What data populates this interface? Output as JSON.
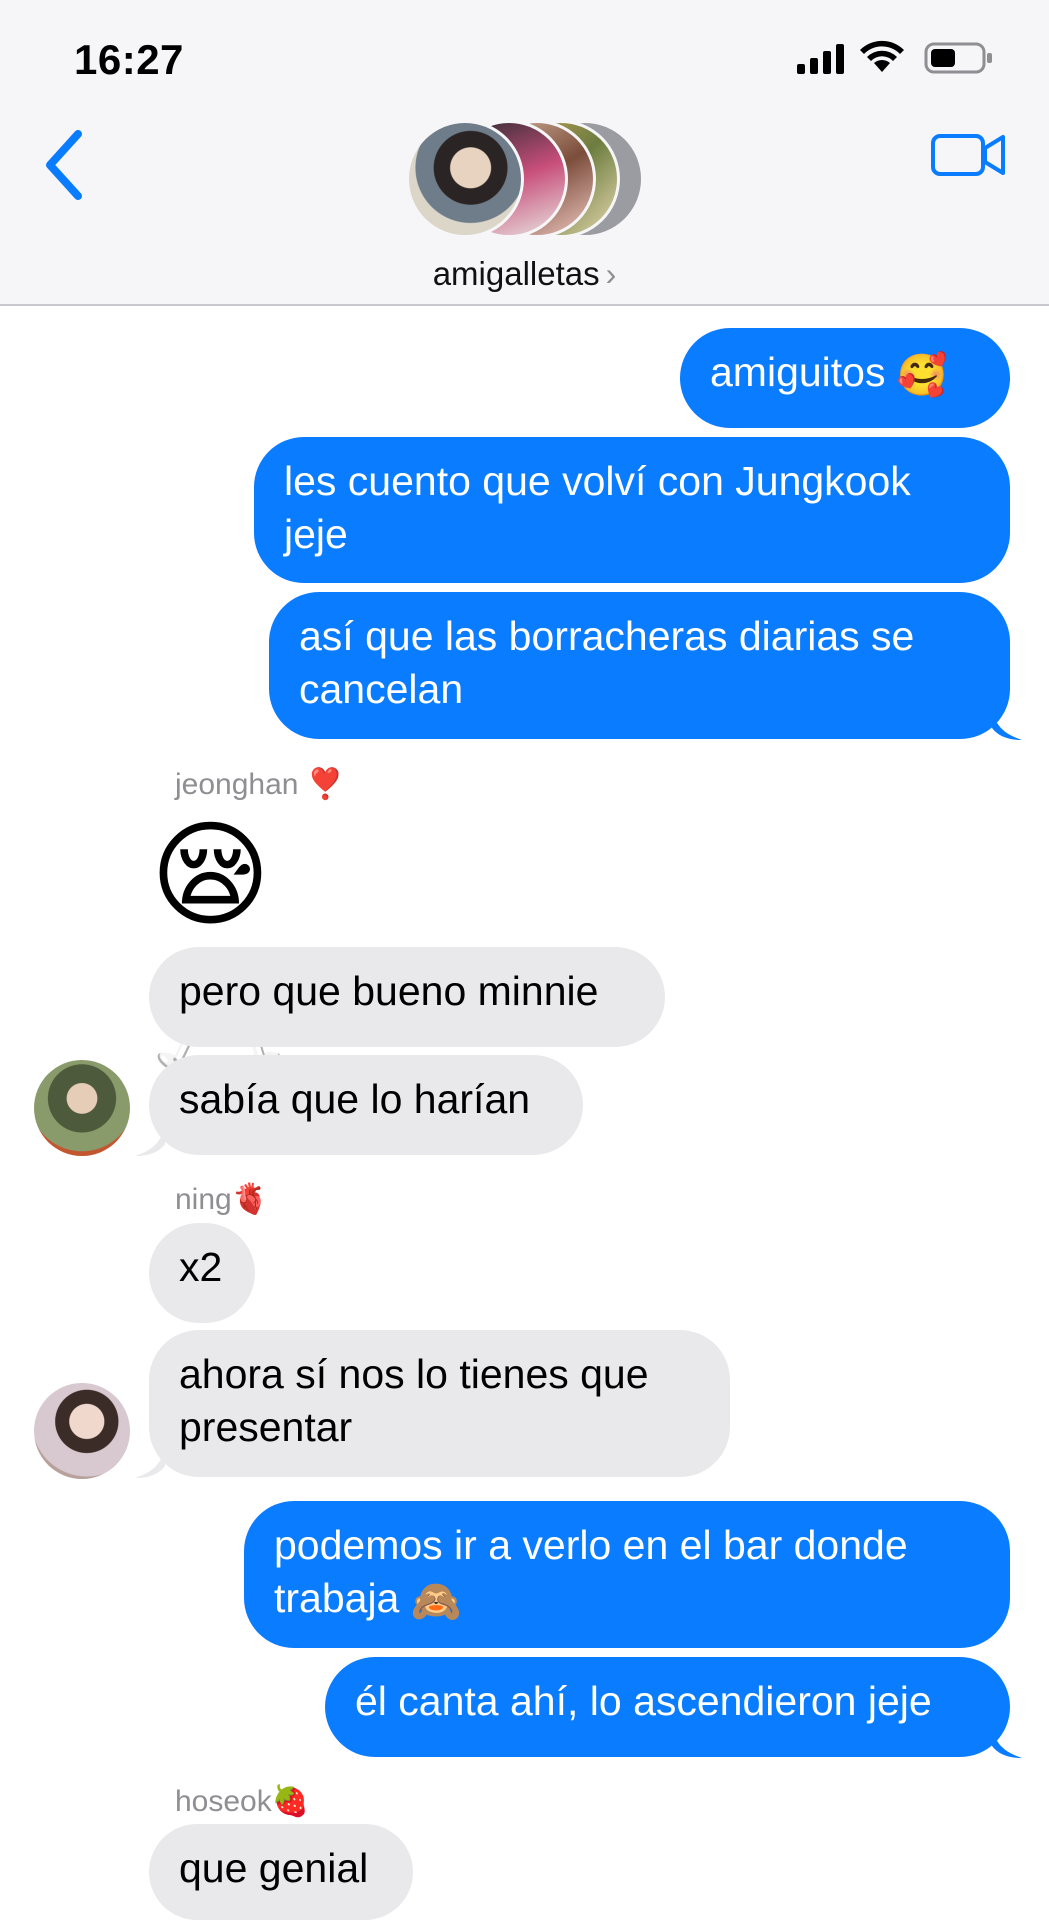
{
  "status_bar": {
    "time": "16:27"
  },
  "header": {
    "group_name": "amigalletas",
    "chevron": "›"
  },
  "colors": {
    "accent": "#0a7cff",
    "incoming": "#e9e9eb",
    "header_bg": "#f6f6f8"
  },
  "icons": [
    "back-chevron-icon",
    "video-call-icon",
    "signal-icon",
    "wifi-icon",
    "battery-icon"
  ],
  "messages": {
    "m1": {
      "text": "amiguitos",
      "emoji": "🥰"
    },
    "m2": {
      "text": "les cuento que volví con Jungkook jeje"
    },
    "m3": {
      "text": "así que las borracheras diarias se cancelan"
    },
    "jeonghan": {
      "name": "jeonghan",
      "emoji": "❣️",
      "big_emoji": "😪🥂"
    },
    "m4": {
      "text": "pero que bueno minnie"
    },
    "m5": {
      "text": "sabía que lo harían"
    },
    "ning": {
      "name": "ning",
      "emoji": "🫀"
    },
    "m6": {
      "text": "x2"
    },
    "m7": {
      "text": "ahora sí nos lo tienes que presentar"
    },
    "m8": {
      "text": "podemos ir a verlo en el bar donde trabaja",
      "emoji": "🙈"
    },
    "m9": {
      "text": "él canta ahí, lo ascendieron jeje"
    },
    "hoseok": {
      "name": "hoseok",
      "emoji": "🍓"
    },
    "m10": {
      "text": "que genial"
    }
  }
}
